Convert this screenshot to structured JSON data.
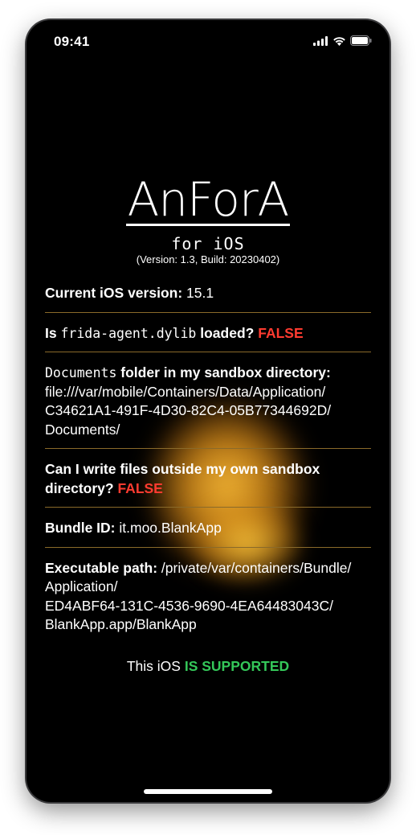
{
  "status_bar": {
    "time": "09:41",
    "icons": [
      "cellular-signal-icon",
      "wifi-icon",
      "battery-icon"
    ]
  },
  "header": {
    "app_title": "AnForA",
    "subtitle": "for iOS",
    "version": "(Version: 1.3, Build: 20230402)"
  },
  "rows": {
    "ios_version": {
      "label": "Current iOS version:",
      "value": "15.1"
    },
    "frida": {
      "label_prefix": "Is",
      "code": "frida-agent.dylib",
      "label_suffix": "loaded?",
      "value": "FALSE"
    },
    "documents": {
      "code": "Documents",
      "label": "folder in my sandbox directory:",
      "value_line1": "file:///var/mobile/Containers/Data/Application/",
      "value_line2": "C34621A1-491F-4D30-82C4-05B77344692D/",
      "value_line3": "Documents/"
    },
    "write_outside": {
      "label": "Can I write files outside my own sandbox directory?",
      "value": "FALSE"
    },
    "bundle_id": {
      "label": "Bundle ID:",
      "value": "it.moo.BlankApp"
    },
    "executable_path": {
      "label": "Executable path:",
      "value_line1": "/private/var/containers/Bundle/",
      "value_line2": "Application/",
      "value_line3": "ED4ABF64-131C-4536-9690-4EA64483043C/",
      "value_line4": "BlankApp.app/BlankApp"
    }
  },
  "support": {
    "prefix": "This iOS",
    "status": "IS SUPPORTED"
  },
  "colors": {
    "false": "#ff3b30",
    "supported": "#34c759",
    "separator": "#8a6a2a",
    "background": "#000000"
  }
}
